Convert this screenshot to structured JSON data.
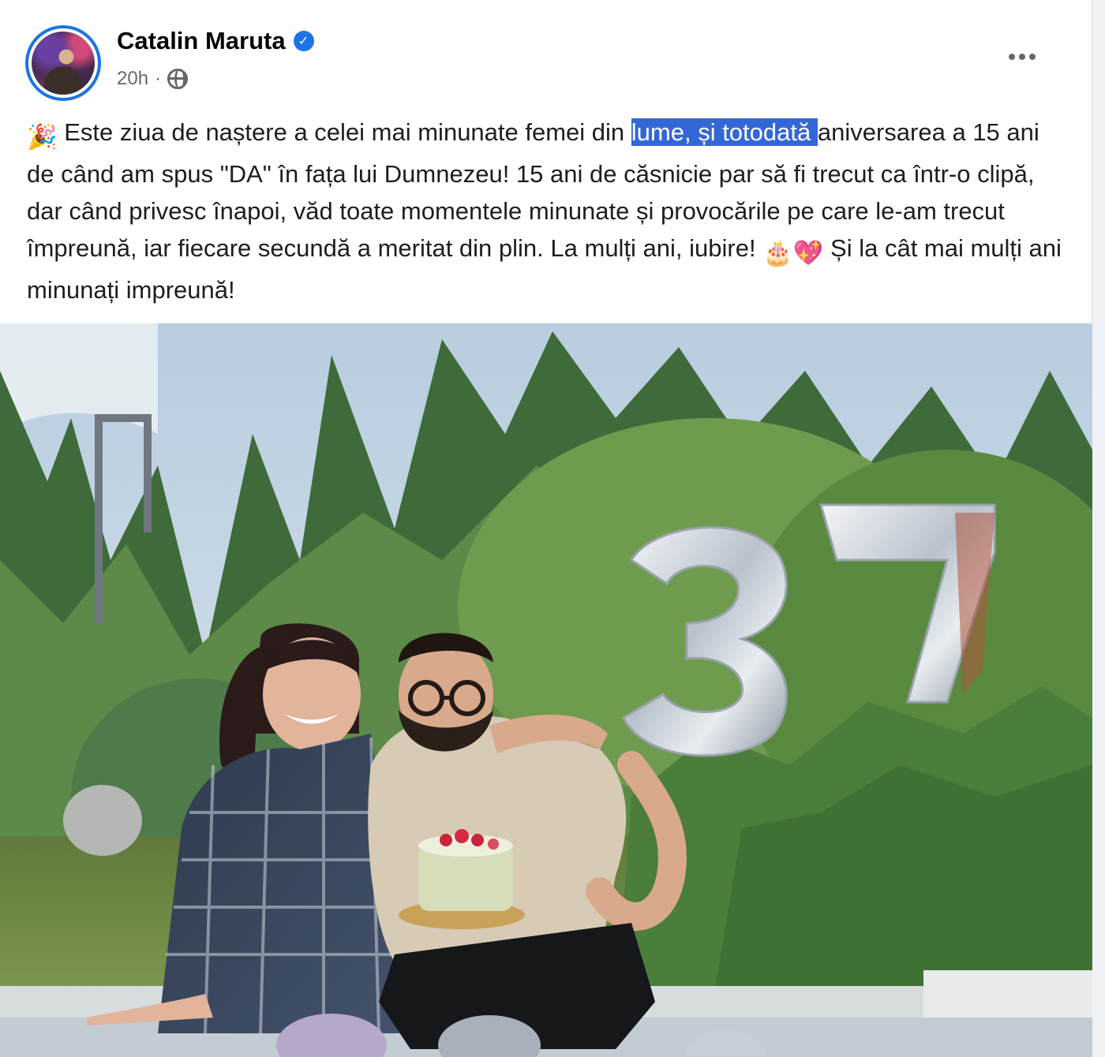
{
  "post": {
    "author": "Catalin Maruta",
    "time": "20h",
    "separator": "·",
    "text": {
      "party_emoji": "🎉",
      "part1": " Este ziua de naștere a celei mai minunate femei din ",
      "highlighted": "lume, și totodată ",
      "part2": "aniversarea a 15 ani de când am spus \"DA\" în fața lui Dumnezeu! 15 ani de căsnicie par să fi trecut ca într-o clipă, dar când privesc înapoi, văd toate momentele minunate și provocările pe care le-am trecut împreună, iar fiecare secundă a meritat din plin. La mulți ani, iubire! ",
      "cake_emoji": "🎂",
      "heart_emoji": "💖",
      "part3": " Și la cât mai mulți ani minunați impreună!"
    },
    "photo": {
      "balloon_number": "37"
    }
  },
  "colors": {
    "verified_blue": "#1b74e4",
    "selection_highlight": "#3367d6",
    "secondary_text": "#65676b"
  },
  "icons": {
    "verified": "verified-badge-icon",
    "audience": "globe-icon",
    "more": "more-options-icon"
  }
}
